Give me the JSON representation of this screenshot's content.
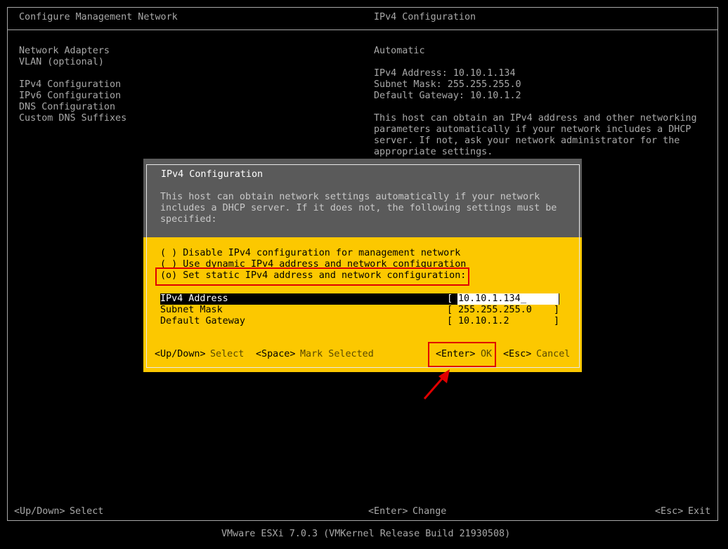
{
  "header": {
    "left_title": "Configure Management Network",
    "right_title": "IPv4 Configuration"
  },
  "menu": {
    "items": [
      "Network Adapters",
      "VLAN (optional)",
      "IPv4 Configuration",
      "IPv6 Configuration",
      "DNS Configuration",
      "Custom DNS Suffixes"
    ]
  },
  "info": {
    "mode": "Automatic",
    "ipv4_address": "IPv4 Address: 10.10.1.134",
    "subnet_mask": "Subnet Mask: 255.255.255.0",
    "default_gateway": "Default Gateway: 10.10.1.2",
    "desc_lines": [
      "This host can obtain an IPv4 address and other networking",
      "parameters automatically if your network includes a DHCP",
      "server. If not, ask your network administrator for the",
      "appropriate settings."
    ]
  },
  "dialog": {
    "title": "IPv4 Configuration",
    "desc_lines": [
      "This host can obtain network settings automatically if your network",
      "includes a DHCP server. If it does not, the following settings must be",
      "specified:"
    ],
    "options": [
      "( ) Disable IPv4 configuration for management network",
      "( ) Use dynamic IPv4 address and network configuration",
      "(o) Set static IPv4 address and network configuration:"
    ],
    "fields": [
      {
        "label": "IPv4 Address",
        "value": "10.10.1.134"
      },
      {
        "label": "Subnet Mask",
        "value": "255.255.255.0"
      },
      {
        "label": "Default Gateway",
        "value": "10.10.1.2"
      }
    ],
    "hints": {
      "updown_key": "<Up/Down>",
      "updown_label": "Select",
      "space_key": "<Space>",
      "space_label": "Mark Selected",
      "enter_key": "<Enter>",
      "enter_label": "OK",
      "esc_key": "<Esc>",
      "esc_label": "Cancel"
    }
  },
  "footer": {
    "updown_key": "<Up/Down>",
    "updown_label": "Select",
    "enter_key": "<Enter>",
    "enter_label": "Change",
    "esc_key": "<Esc>",
    "esc_label": "Exit",
    "version": "VMware ESXi 7.0.3 (VMKernel Release Build 21930508)"
  },
  "colors": {
    "dialog_bg": "#fcc800",
    "dialog_header_bg": "#5a5a5a",
    "highlight": "#e00000",
    "selected_row_bg": "#000000"
  },
  "icons": [
    "arrow-icon"
  ]
}
